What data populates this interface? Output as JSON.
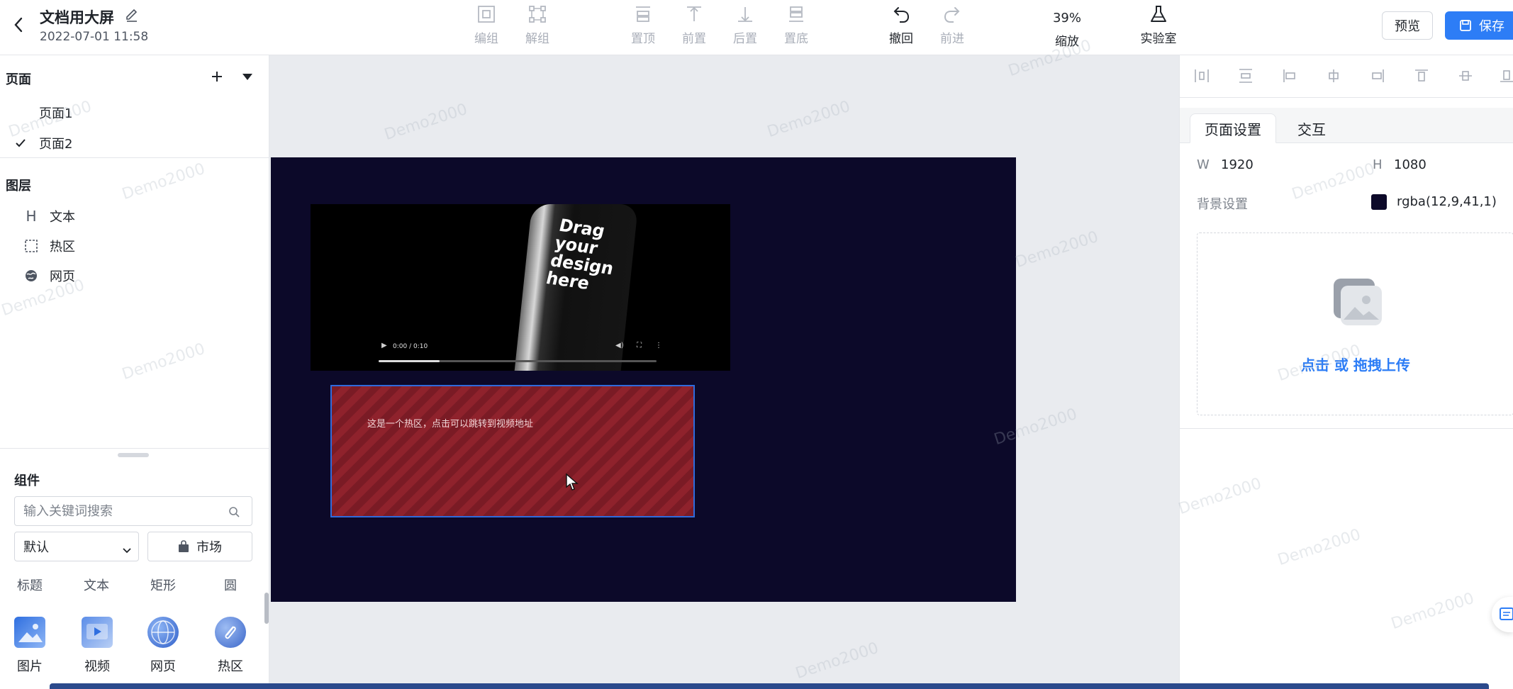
{
  "header": {
    "title": "文档用大屏",
    "date": "2022-07-01 11:58",
    "tools": {
      "group": "编组",
      "ungroup": "解组",
      "top": "置顶",
      "forward": "前置",
      "backward": "后置",
      "bottom": "置底",
      "undo": "撤回",
      "redo": "前进",
      "zoom_value": "39%",
      "zoom": "缩放",
      "lab": "实验室"
    },
    "preview": "预览",
    "save": "保存"
  },
  "pages": {
    "title": "页面",
    "items": [
      {
        "label": "页面1",
        "selected": false
      },
      {
        "label": "页面2",
        "selected": true
      }
    ]
  },
  "layers": {
    "title": "图层",
    "items": [
      {
        "label": "文本",
        "icon": "heading-icon"
      },
      {
        "label": "热区",
        "icon": "hotzone-icon"
      },
      {
        "label": "网页",
        "icon": "globe-icon"
      }
    ]
  },
  "components": {
    "title": "组件",
    "search_placeholder": "输入关键词搜索",
    "filter_value": "默认",
    "market": "市场",
    "categories": [
      "标题",
      "文本",
      "矩形",
      "圆"
    ],
    "items": [
      {
        "label": "图片",
        "icon": "image-icon"
      },
      {
        "label": "视频",
        "icon": "video-icon"
      },
      {
        "label": "网页",
        "icon": "globe-icon"
      },
      {
        "label": "热区",
        "icon": "hotzone-icon"
      }
    ]
  },
  "canvas": {
    "video": {
      "screen_text": "Drag your design here",
      "time": "0:00 / 0:10",
      "progress": 0.22
    },
    "hotzone_text": "这是一个热区，点击可以跳转到视频地址",
    "background": "#0c0929",
    "watermark": "Demo2000"
  },
  "properties": {
    "tabs": [
      "页面设置",
      "交互"
    ],
    "active_tab": 0,
    "width_label": "W",
    "width_value": "1920",
    "height_label": "H",
    "height_value": "1080",
    "bg_label": "背景设置",
    "bg_value": "rgba(12,9,41,1)",
    "upload_text": "点击 或 拖拽上传"
  },
  "colors": {
    "accent": "#2d7df6",
    "stage": "#0c0929",
    "hotzone": "#8f222c"
  }
}
